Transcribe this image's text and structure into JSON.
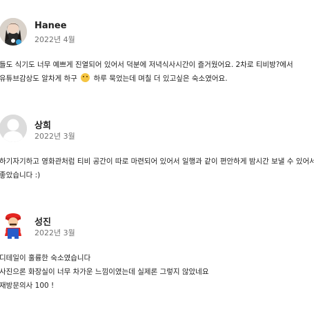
{
  "reviews": [
    {
      "name": "Hanee",
      "date": "2022년 4월",
      "avatar_icon": "user-photo-avatar",
      "lines": [
        "들도 식기도 너무 예쁘게 진열되어 있어서 덕분에 저녁식사시간이 즐거웠어요. 2차로 티비방?에서",
        "유튜브감상도 알차게 하구",
        "하루 묵었는데 며칠 더 있고싶은 숙소였어요."
      ]
    },
    {
      "name": "상희",
      "date": "2022년 3월",
      "avatar_icon": "default-user-avatar",
      "lines": [
        "하기자기하고 영화관처럼 티비 공간이 따로 마련되어 있어서 일행과 같이 편안하게 밤시간 보낼 수 있어서",
        "좋았습니다 :)"
      ]
    },
    {
      "name": "성진",
      "date": "2022년 3월",
      "avatar_icon": "mario-character-avatar",
      "lines": [
        "디테일이 훌륭한 숙소였습니다",
        "사진으론 화장실이 너무 차가운 느낌이였는데 실제론 그렇지 않았네요",
        "재방문의사 100 !"
      ]
    }
  ],
  "emoji_icon": "smiling-face-emoji"
}
